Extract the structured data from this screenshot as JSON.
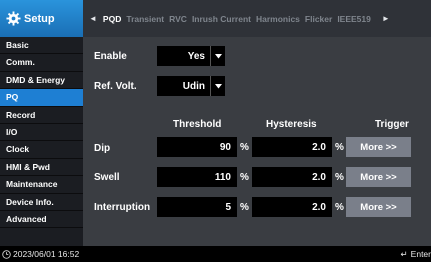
{
  "app": {
    "title": "Setup"
  },
  "tabs": {
    "prev_arrow": "◄",
    "next_arrow": "►",
    "items": [
      "PQD",
      "Transient",
      "RVC",
      "Inrush Current",
      "Harmonics",
      "Flicker",
      "IEEE519"
    ],
    "active_index": 0
  },
  "sidebar": {
    "items": [
      "Basic",
      "Comm.",
      "DMD & Energy",
      "PQ",
      "Record",
      "I/O",
      "Clock",
      "HMI & Pwd",
      "Maintenance",
      "Device Info.",
      "Advanced"
    ],
    "active_index": 3
  },
  "form": {
    "enable": {
      "label": "Enable",
      "value": "Yes"
    },
    "ref_volt": {
      "label": "Ref. Volt.",
      "value": "Udin"
    }
  },
  "table": {
    "headers": {
      "threshold": "Threshold",
      "hysteresis": "Hysteresis",
      "trigger": "Trigger"
    },
    "rows": [
      {
        "name": "Dip",
        "threshold": "90",
        "threshold_unit": "%",
        "hysteresis": "2.0",
        "hysteresis_unit": "%",
        "trigger": "More >>"
      },
      {
        "name": "Swell",
        "threshold": "110",
        "threshold_unit": "%",
        "hysteresis": "2.0",
        "hysteresis_unit": "%",
        "trigger": "More >>"
      },
      {
        "name": "Interruption",
        "threshold": "5",
        "threshold_unit": "%",
        "hysteresis": "2.0",
        "hysteresis_unit": "%",
        "trigger": "More >>"
      }
    ]
  },
  "status": {
    "datetime": "2023/06/01 16:52",
    "enter_label": "Enter",
    "enter_icon": "↵"
  },
  "icons": {
    "logo": "gear-icon",
    "clock": "clock-icon",
    "dropdown": "caret-down-icon"
  },
  "colors": {
    "accent": "#1e7fd3",
    "panel": "#3a3d42",
    "button": "#7a7f8a"
  }
}
